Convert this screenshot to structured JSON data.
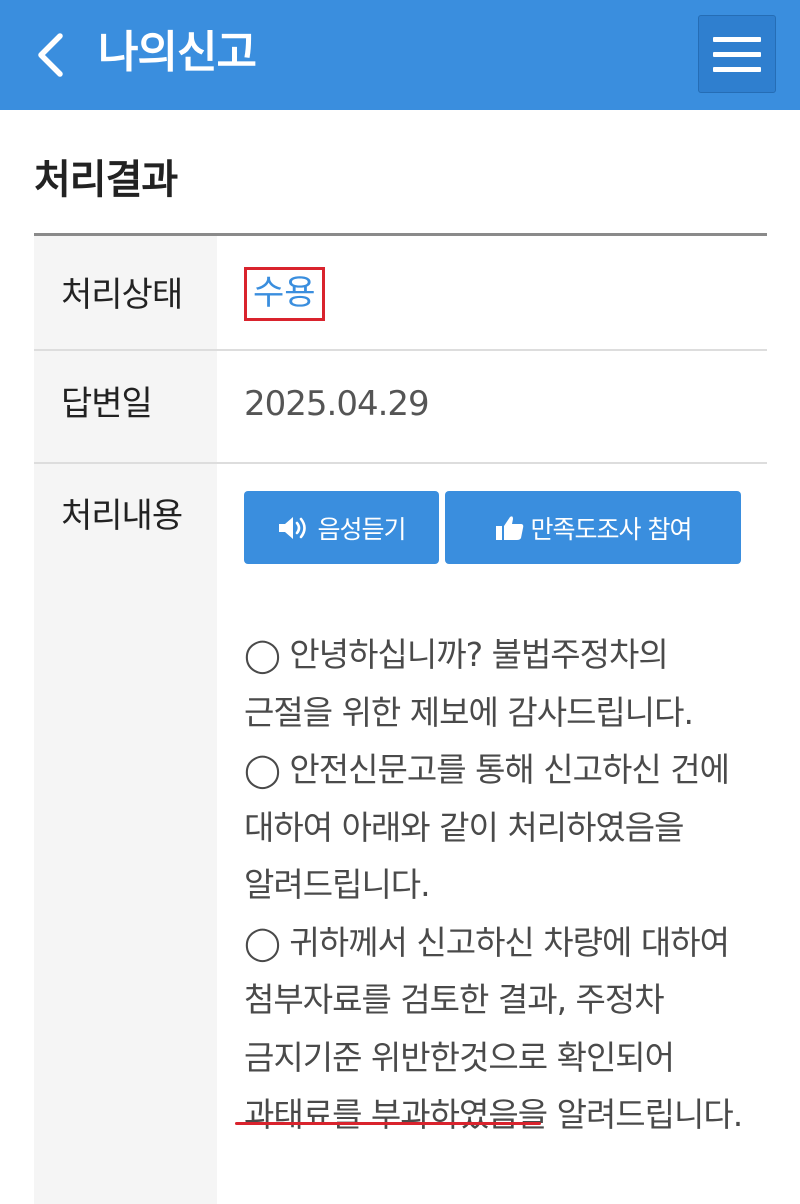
{
  "header": {
    "title": "나의신고",
    "back_icon": "chevron-left-icon",
    "menu_icon": "hamburger-menu-icon"
  },
  "section": {
    "title": "처리결과"
  },
  "result": {
    "status_label": "처리상태",
    "status_value": "수용",
    "answer_date_label": "답변일",
    "answer_date_value": "2025.04.29",
    "content_label": "처리내용",
    "listen_button": "음성듣기",
    "listen_icon": "speaker-icon",
    "survey_button": "만족도조사 참여",
    "survey_icon": "thumbs-up-icon",
    "content_paragraphs": [
      "◯ 안녕하십니까? 불법주정차의 근절을 위한 제보에 감사드립니다.",
      "◯ 안전신문고를 통해 신고하신 건에 대하여 아래와 같이 처리하였음을 알려드립니다.",
      "◯ 귀하께서 신고하신 차량에 대하여 첨부자료를 검토한 결과, 주정차 금지기준 위반한것으로 확인되어 과태료를 부과하였음을 알려드립니다."
    ]
  },
  "colors": {
    "header_bg": "#3a8ede",
    "accent": "#3a8ede",
    "highlight_red": "#d9232d"
  }
}
